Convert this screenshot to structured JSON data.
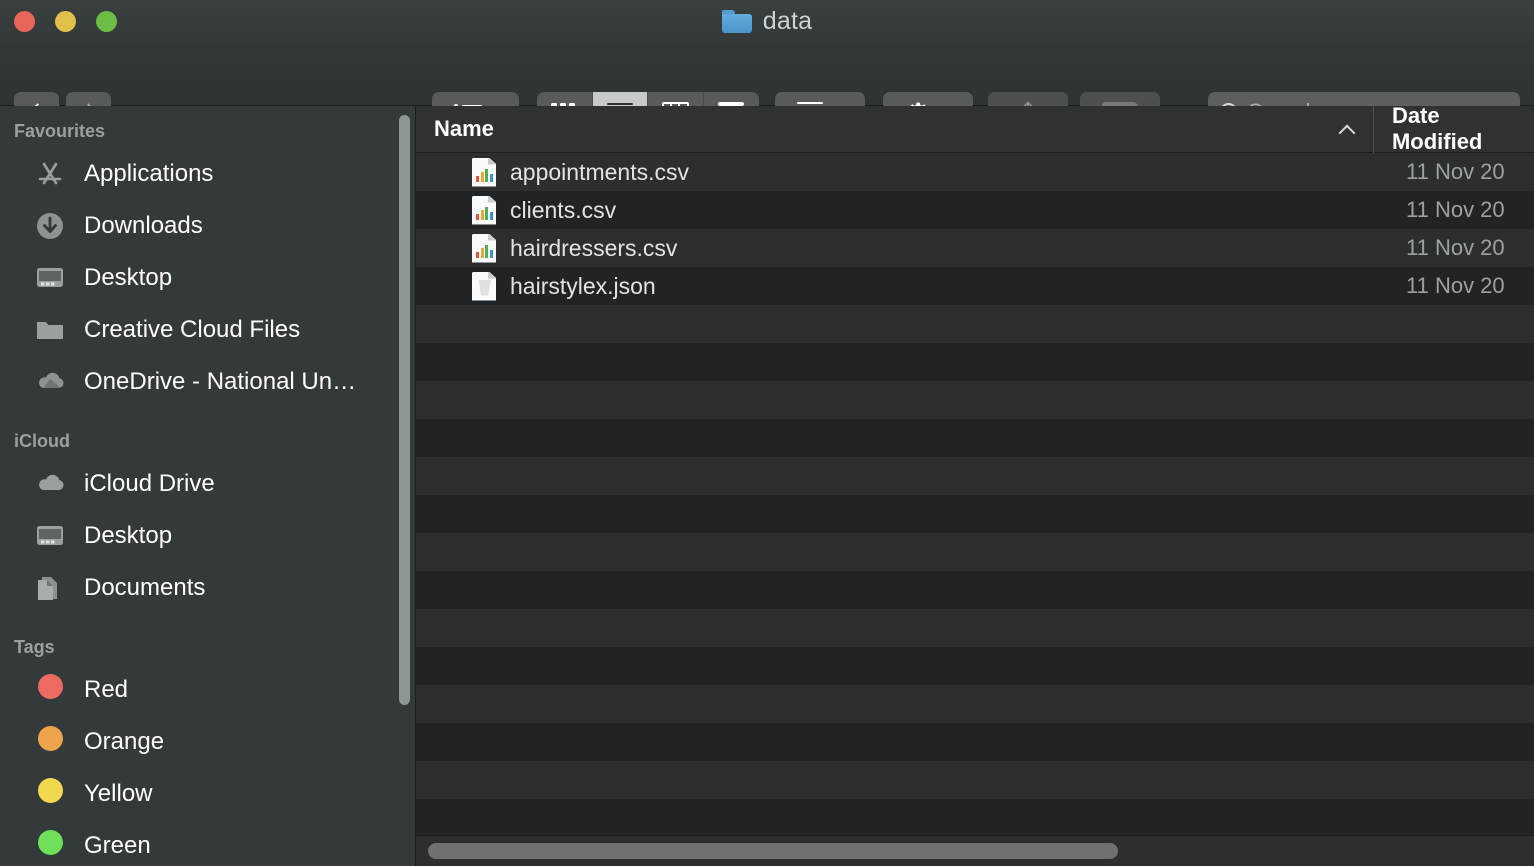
{
  "window": {
    "title": "data",
    "title_icon": "blue-folder-icon",
    "traffic_lights": [
      {
        "name": "close",
        "color": "#e8655a"
      },
      {
        "name": "minimise",
        "color": "#e0c04a"
      },
      {
        "name": "zoom",
        "color": "#6cbd43"
      }
    ]
  },
  "toolbar": {
    "back_icon": "chevron-left-icon",
    "forward_icon": "chevron-right-icon",
    "group_menu_icon": "list-bullets-icon",
    "view_modes": [
      {
        "name": "icon-view",
        "icon": "grid-icon",
        "active": false
      },
      {
        "name": "list-view",
        "icon": "lines-icon",
        "active": true
      },
      {
        "name": "column-view",
        "icon": "columns-icon",
        "active": false
      },
      {
        "name": "gallery-view",
        "icon": "gallery-icon",
        "active": false
      }
    ],
    "group_by_icon": "group-by-icon",
    "action_icon": "gear-icon",
    "share_icon": "share-icon",
    "tag_icon": "tag-icon"
  },
  "search": {
    "icon": "search-icon",
    "placeholder": "Search",
    "value": ""
  },
  "sidebar": {
    "sections": [
      {
        "heading": "Favourites",
        "items": [
          {
            "label": "Applications",
            "icon": "app-store-icon"
          },
          {
            "label": "Downloads",
            "icon": "download-arrow-icon"
          },
          {
            "label": "Desktop",
            "icon": "desktop-icon"
          },
          {
            "label": "Creative Cloud Files",
            "icon": "folder-icon"
          },
          {
            "label": "OneDrive - National Un…",
            "icon": "cloud-icon"
          }
        ]
      },
      {
        "heading": "iCloud",
        "items": [
          {
            "label": "iCloud Drive",
            "icon": "cloud-icon"
          },
          {
            "label": "Desktop",
            "icon": "desktop-icon"
          },
          {
            "label": "Documents",
            "icon": "documents-icon"
          }
        ]
      },
      {
        "heading": "Tags",
        "items": [
          {
            "label": "Red",
            "icon": "tag-dot-icon",
            "color": "#ed6a5e"
          },
          {
            "label": "Orange",
            "icon": "tag-dot-icon",
            "color": "#eda44b"
          },
          {
            "label": "Yellow",
            "icon": "tag-dot-icon",
            "color": "#f2d84e"
          },
          {
            "label": "Green",
            "icon": "tag-dot-icon",
            "color": "#6ee05a"
          }
        ]
      }
    ]
  },
  "filelist": {
    "columns": [
      {
        "key": "name",
        "label": "Name",
        "sorted": true,
        "sort_icon": "chevron-up-icon"
      },
      {
        "key": "date",
        "label": "Date Modified",
        "sorted": false
      }
    ],
    "rows": [
      {
        "name": "appointments.csv",
        "icon": "csv-file-icon",
        "date": "11 Nov 20"
      },
      {
        "name": "clients.csv",
        "icon": "csv-file-icon",
        "date": "11 Nov 20"
      },
      {
        "name": "hairdressers.csv",
        "icon": "csv-file-icon",
        "date": "11 Nov 20"
      },
      {
        "name": "hairstylex.json",
        "icon": "json-file-icon",
        "date": "11 Nov 20"
      }
    ]
  },
  "scrollbars": {
    "sidebar_vertical": "visible",
    "content_horizontal": "visible"
  }
}
